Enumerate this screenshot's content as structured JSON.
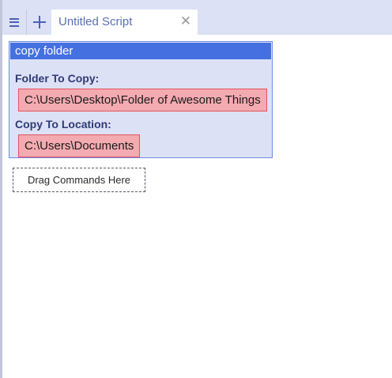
{
  "toolbar": {
    "menu_icon": "hamburger-menu-icon",
    "add_icon": "plus-icon",
    "close_icon": "close-icon",
    "close_glyph": "✕"
  },
  "tabs": [
    {
      "label": "Untitled Script"
    }
  ],
  "command": {
    "title": "copy folder",
    "params": [
      {
        "label": "Folder To Copy:",
        "value": "C:\\Users\\Desktop\\Folder of Awesome Things"
      },
      {
        "label": "Copy To Location:",
        "value": "C:\\Users\\Documents"
      }
    ]
  },
  "drop_zone": {
    "label": "Drag Commands Here"
  },
  "colors": {
    "accent": "#4470e0",
    "panel_bg": "#dde1f5",
    "value_bg": "#f3aab0",
    "value_border": "#e0555e",
    "label_text": "#2e3a76"
  }
}
